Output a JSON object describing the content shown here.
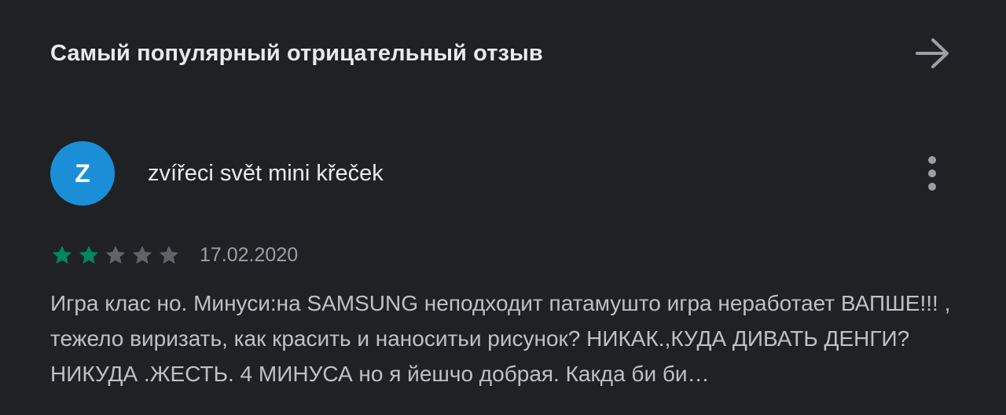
{
  "header": {
    "title": "Самый популярный отрицательный отзыв",
    "arrow_icon": "arrow-right-icon"
  },
  "review": {
    "avatar_letter": "Z",
    "avatar_color": "#1a8fd7",
    "author": "zvířeci svět mini křeček",
    "more_icon": "more-vert-icon",
    "rating": 2,
    "max_rating": 5,
    "star_filled_color": "#01875f",
    "star_empty_color": "#5f6368",
    "date": "17.02.2020",
    "text": "Игра клас но. Минуси:на SAMSUNG неподходит патамушто игра неработает ВАПШЕ!!! , тежело виризать, как красить и наноситьи рисунок? НИКАК.,КУДА ДИВАТЬ ДЕНГИ?НИКУДА .ЖЕСТЬ. 4 МИНУСА но я йешчо добрая. Какда би би…"
  }
}
